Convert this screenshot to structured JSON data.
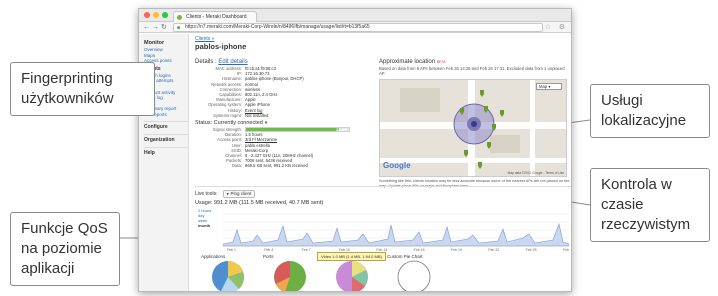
{
  "callouts": {
    "fingerprinting": "Fingerprinting użytkowników",
    "location": "Usługi lokalizacyjne",
    "realtime": "Kontrola w czasie rzeczywistym",
    "qos": "Funkcje QoS na poziomie aplikacji"
  },
  "browser": {
    "tab_title": "Clients - Meraki Dashboard",
    "url": "https://n7.meraki.com/Meraki-Corp-Wirele/n/8496Ifb/manage/usage/list#t=b13f5a65"
  },
  "sidebar": {
    "monitor": "Monitor",
    "monitor_items": [
      "Overview",
      "Maps",
      "Access points"
    ],
    "clients": "Clients",
    "client_items": [
      "Splash logins",
      "Login attempts",
      "NAC",
      "Account activity",
      "Event log",
      "WIPS",
      "Summary report",
      "PCI reports"
    ],
    "configure": "Configure",
    "organization": "Organization",
    "help": "Help"
  },
  "main": {
    "breadcrumb": "Clients »",
    "title": "pablos-iphone",
    "details_label": "Details :",
    "details_link": "Edit details",
    "details": [
      {
        "k": "MAC address:",
        "v": "f0:cb:a1:f9:08:c3"
      },
      {
        "k": "IP:",
        "v": "172.16.30.73"
      },
      {
        "k": "Hostname:",
        "v": "pablos-iphone (Bonjour, DHCP)"
      },
      {
        "k": "Network access:",
        "v": "normal"
      },
      {
        "k": "Connection:",
        "v": "wireless"
      },
      {
        "k": "Capabilities:",
        "v": "802.11n, 2.4 GHz"
      },
      {
        "k": "Manufacturer:",
        "v": "Apple"
      },
      {
        "k": "Operating system:",
        "v": "Apple iPhone"
      },
      {
        "k": "History:",
        "v": "Event log"
      },
      {
        "k": "Systems mgmt:",
        "v": "Not Installed"
      }
    ],
    "status_label": "Status: Currently connected",
    "signal_label": "Signal strength:",
    "signal_value": "33 dB",
    "signal_fraction": 0.9,
    "conn": [
      {
        "k": "Duration:",
        "v": "1.5 hours"
      },
      {
        "k": "Access point:",
        "v": "3rd Fl Mezzanine"
      },
      {
        "k": "User:",
        "v": "pablo.estrella"
      },
      {
        "k": "SSID:",
        "v": "Meraki-Corp"
      },
      {
        "k": "Channel:",
        "v": "6 - 2.437 GHz (11n, 20MHz channel)"
      },
      {
        "k": "Packets:",
        "v": "7006 sent, 5436 received"
      },
      {
        "k": "Data:",
        "v": "669.5 KB sent, 991.2 KB received"
      }
    ],
    "location_title": "Approximate location",
    "location_beta": "BETA",
    "location_sub": "Based on data from 8 APs between Feb 26 14:26 and Feb 26 17:31. Excluded data from 1 unplaced AP.",
    "map_type": "Map",
    "map_brand": "Google",
    "map_footer": "Map data ©2012 Google - Terms of Use",
    "location_note": "Something like this: clients location may be less accurate because some of the nearest APs are not placed on the map. Update place APs on maps and floorplans here.",
    "live_tools": "Live tools:",
    "ping_button": "Ping client",
    "usage_title": "Usage: 991.2 MB (111.5 MB received, 40.7 MB sent)",
    "usage_options": [
      "2 hours",
      "day",
      "week",
      "month"
    ],
    "usage_dates": [
      "Feb 1",
      "Feb 4",
      "Feb 7",
      "Feb 10",
      "Feb 13",
      "Feb 16",
      "Feb 19",
      "Feb 22",
      "Feb 25",
      "Feb 4"
    ],
    "pies": [
      "Applications",
      "Ports",
      "Content",
      "Custom Pie Chart"
    ],
    "tooltip": "Video 1.0 MB (1.4 MB, 1.94.0 MB)"
  }
}
